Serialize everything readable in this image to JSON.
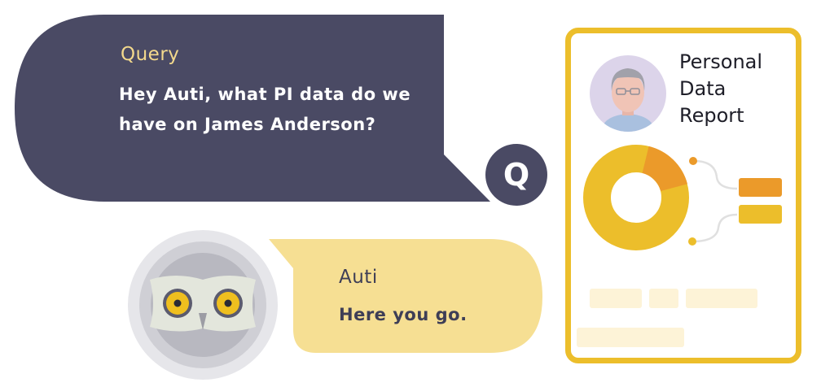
{
  "query": {
    "label": "Query",
    "text": "Hey Auti, what PI data do we have on James Anderson?"
  },
  "q_badge": {
    "letter": "Q"
  },
  "answer": {
    "name": "Auti",
    "text": "Here you go."
  },
  "report": {
    "title_line1": "Personal",
    "title_line2": "Data",
    "title_line3": "Report"
  },
  "colors": {
    "query_bubble": "#4a4a64",
    "query_label": "#f3d98c",
    "answer_bubble": "#f6df93",
    "card_border": "#ecbe2b",
    "donut_main": "#ecbe2b",
    "donut_accent": "#eb9a2a",
    "placeholder": "#fdf3d7"
  },
  "icons": {
    "owl": "owl-icon",
    "person": "person-avatar-icon",
    "chart": "donut-chart-icon"
  }
}
